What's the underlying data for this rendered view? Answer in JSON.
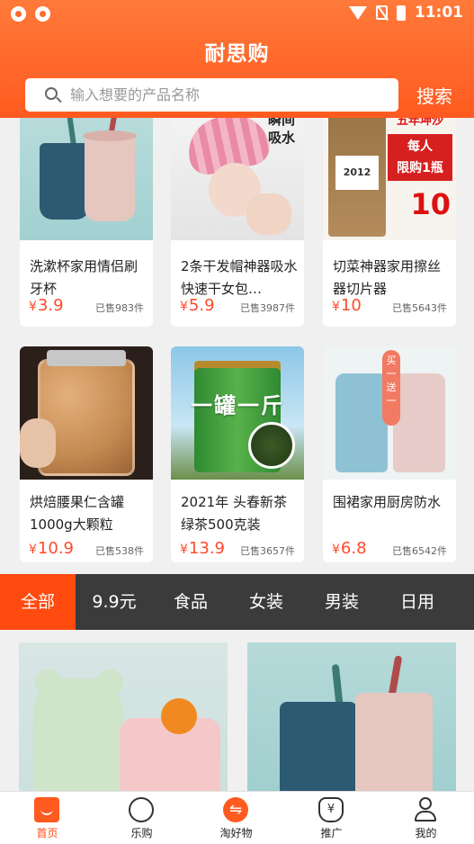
{
  "status_bar": {
    "time": "11:01"
  },
  "header": {
    "title": "耐思购",
    "search_placeholder": "输入想要的产品名称",
    "search_button": "搜索"
  },
  "products": [
    {
      "name": "洗漱杯家用情侣刷牙杯",
      "currency": "¥",
      "price": "3.9",
      "sold": "已售983件"
    },
    {
      "name": "2条干发帽神器吸水快速干女包…",
      "currency": "¥",
      "price": "5.9",
      "sold": "已售3987件",
      "image_text": "瞬间吸水"
    },
    {
      "name": "切菜神器家用擦丝器切片器",
      "currency": "¥",
      "price": "10",
      "sold": "已售5643件",
      "image_text": {
        "top": "五年坤沙",
        "promo_line1": "每人",
        "promo_line2": "限购1瓶",
        "price": "10",
        "bag_label": "2012"
      }
    },
    {
      "name": "烘焙腰果仁含罐1000g大颗粒",
      "currency": "¥",
      "price": "10.9",
      "sold": "已售538件"
    },
    {
      "name": "2021年 头春新茶绿茶500克装",
      "currency": "¥",
      "price": "13.9",
      "sold": "已售3657件",
      "image_text": "一罐一斤"
    },
    {
      "name": "围裙家用厨房防水",
      "currency": "¥",
      "price": "6.8",
      "sold": "已售6542件",
      "image_text": "买一送一"
    }
  ],
  "categories": [
    "全部",
    "9.9元",
    "食品",
    "女装",
    "男装",
    "日用"
  ],
  "bottom_nav": [
    {
      "label": "首页",
      "icon": "home-icon"
    },
    {
      "label": "乐购",
      "icon": "shopping-icon"
    },
    {
      "label": "淘好物",
      "icon": "exchange-icon"
    },
    {
      "label": "推广",
      "icon": "money-bag-icon"
    },
    {
      "label": "我的",
      "icon": "user-icon"
    }
  ],
  "colors": {
    "accent": "#ff5a1f",
    "price": "#ff4a2a",
    "category_bar": "#3b3b3b"
  }
}
